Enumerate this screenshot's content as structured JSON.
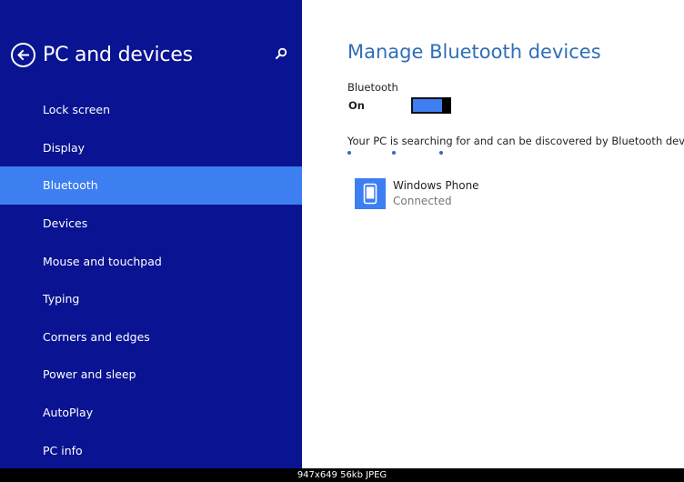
{
  "sidebar": {
    "title": "PC and devices",
    "items": [
      {
        "label": "Lock screen"
      },
      {
        "label": "Display"
      },
      {
        "label": "Bluetooth",
        "active": true
      },
      {
        "label": "Devices"
      },
      {
        "label": "Mouse and touchpad"
      },
      {
        "label": "Typing"
      },
      {
        "label": "Corners and edges"
      },
      {
        "label": "Power and sleep"
      },
      {
        "label": "AutoPlay"
      },
      {
        "label": "PC info"
      }
    ]
  },
  "main": {
    "title": "Manage Bluetooth devices",
    "bluetooth_label": "Bluetooth",
    "bluetooth_state": "On",
    "search_message": "Your PC is searching for and can be discovered by Bluetooth devices.",
    "devices": [
      {
        "name": "Windows Phone",
        "status": "Connected"
      }
    ]
  },
  "image_caption": "947x649  56kb  JPEG",
  "colors": {
    "sidebar_bg": "#0a1391",
    "accent": "#3d7ef0",
    "title_blue": "#2e6fb8"
  },
  "icons": {
    "back": "back-arrow-circle-icon",
    "search": "search-icon",
    "device": "phone-icon"
  }
}
